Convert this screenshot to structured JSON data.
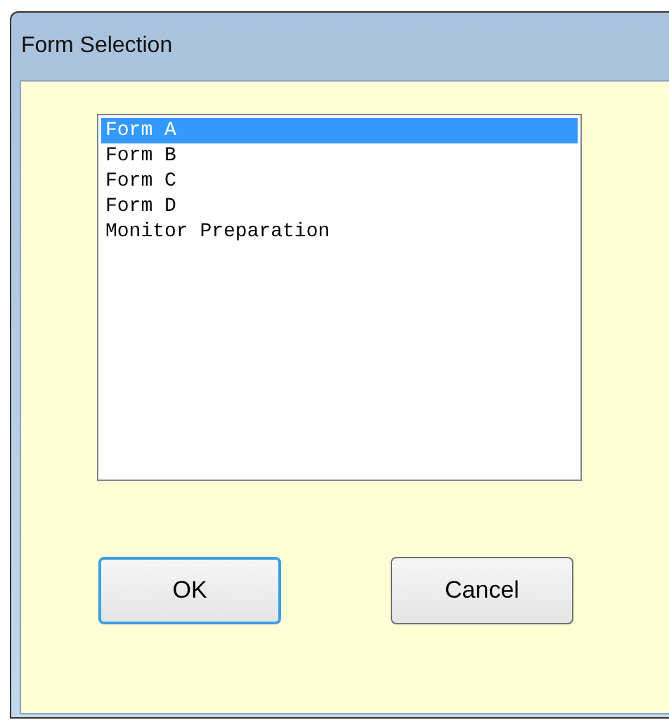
{
  "window": {
    "title": "Form Selection"
  },
  "list": {
    "items": [
      {
        "label": "Form A",
        "selected": true
      },
      {
        "label": "Form B",
        "selected": false
      },
      {
        "label": "Form C",
        "selected": false
      },
      {
        "label": "Form D",
        "selected": false
      },
      {
        "label": "Monitor Preparation",
        "selected": false
      }
    ]
  },
  "buttons": [
    {
      "label": "OK",
      "default": true
    },
    {
      "label": "Cancel",
      "default": false
    }
  ]
}
